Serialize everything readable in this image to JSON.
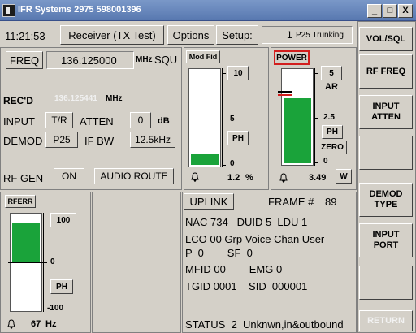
{
  "window": {
    "title": "IFR Systems 2975 598001396",
    "minimize": "_",
    "maximize": "□",
    "close": "X"
  },
  "toolbar": {
    "time": "11:21:53",
    "mode": "Receiver (TX Test)",
    "options": "Options",
    "setup_label": "Setup:",
    "setup_value": "1",
    "setup_mode": "P25 Trunking"
  },
  "receiver": {
    "freq_label": "FREQ",
    "freq_value": "136.125000",
    "freq_unit": "MHz",
    "squ": "SQU",
    "recd_label": "REC'D",
    "recd_value": "136.125441",
    "recd_unit": "MHz",
    "input_label": "INPUT",
    "input_value": "T/R",
    "atten_label": "ATTEN",
    "atten_value": "0",
    "atten_unit": "dB",
    "demod_label": "DEMOD",
    "demod_value": "P25",
    "ifbw_label": "IF BW",
    "ifbw_value": "12.5kHz",
    "rfgen_label": "RF GEN",
    "rfgen_value": "ON",
    "audio_route": "AUDIO ROUTE"
  },
  "modfid": {
    "title": "Mod Fid",
    "scale_top": "10",
    "scale_mid": "5",
    "scale_bot": "0",
    "ph": "PH",
    "value": "1.2",
    "unit": "%",
    "level_fraction": 0.12
  },
  "power": {
    "title": "POWER",
    "scale_top": "5",
    "ar": "AR",
    "scale_mid": "2.5",
    "ph": "PH",
    "zero": "ZERO",
    "scale_bot": "0",
    "value": "3.49",
    "unit": "W",
    "level_fraction": 0.7
  },
  "rferr": {
    "title": "RFERR",
    "scale_top": "100",
    "scale_mid": "0",
    "scale_bot": "-100",
    "ph": "PH",
    "value": "67",
    "unit": "Hz",
    "level_fraction": 0.835
  },
  "uplink": {
    "title": "UPLINK",
    "frame_label": "FRAME #",
    "frame_value": "89",
    "line1": "NAC 734   DUID 5  LDU 1",
    "line2": "LCO 00 Grp Voice Chan User",
    "line3": "P  0        SF  0",
    "line4": "MFID 00        EMG 0",
    "line5": "TGID 0001    SID  000001",
    "status": "STATUS  2  Unknwn,in&outbound"
  },
  "sidebar": {
    "items": [
      {
        "label": "VOL/SQL"
      },
      {
        "label": "RF FREQ"
      },
      {
        "label": "INPUT ATTEN"
      },
      {
        "label": ""
      },
      {
        "label": "DEMOD TYPE"
      },
      {
        "label": "INPUT PORT"
      },
      {
        "label": ""
      },
      {
        "label": "RETURN"
      }
    ]
  },
  "icons": {
    "bell": "bell-icon"
  },
  "colors": {
    "bar_fill": "#1aa33a",
    "power_highlight": "#d21e1e",
    "title_bg": "#5878b0"
  }
}
